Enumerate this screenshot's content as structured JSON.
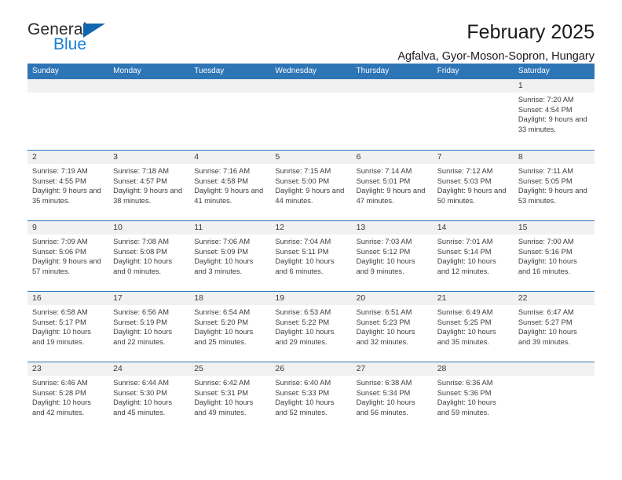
{
  "brand": {
    "name_top": "General",
    "name_bottom": "Blue",
    "triangle_icon": "triangle-icon",
    "accent_color": "#1a7fd4"
  },
  "header": {
    "title": "February 2025",
    "subtitle": "Agfalva, Gyor-Moson-Sopron, Hungary"
  },
  "colors": {
    "header_blue": "#2e75b6",
    "daynum_gray": "#f1f1f1",
    "text": "#3d3d3d"
  },
  "calendar": {
    "weekdays": [
      "Sunday",
      "Monday",
      "Tuesday",
      "Wednesday",
      "Thursday",
      "Friday",
      "Saturday"
    ],
    "labels": {
      "sunrise": "Sunrise:",
      "sunset": "Sunset:",
      "daylight": "Daylight:"
    },
    "weeks": [
      [
        {
          "day": "",
          "empty": true
        },
        {
          "day": "",
          "empty": true
        },
        {
          "day": "",
          "empty": true
        },
        {
          "day": "",
          "empty": true
        },
        {
          "day": "",
          "empty": true
        },
        {
          "day": "",
          "empty": true
        },
        {
          "day": "1",
          "sunrise": "Sunrise: 7:20 AM",
          "sunset": "Sunset: 4:54 PM",
          "daylight": "Daylight: 9 hours and 33 minutes."
        }
      ],
      [
        {
          "day": "2",
          "sunrise": "Sunrise: 7:19 AM",
          "sunset": "Sunset: 4:55 PM",
          "daylight": "Daylight: 9 hours and 35 minutes."
        },
        {
          "day": "3",
          "sunrise": "Sunrise: 7:18 AM",
          "sunset": "Sunset: 4:57 PM",
          "daylight": "Daylight: 9 hours and 38 minutes."
        },
        {
          "day": "4",
          "sunrise": "Sunrise: 7:16 AM",
          "sunset": "Sunset: 4:58 PM",
          "daylight": "Daylight: 9 hours and 41 minutes."
        },
        {
          "day": "5",
          "sunrise": "Sunrise: 7:15 AM",
          "sunset": "Sunset: 5:00 PM",
          "daylight": "Daylight: 9 hours and 44 minutes."
        },
        {
          "day": "6",
          "sunrise": "Sunrise: 7:14 AM",
          "sunset": "Sunset: 5:01 PM",
          "daylight": "Daylight: 9 hours and 47 minutes."
        },
        {
          "day": "7",
          "sunrise": "Sunrise: 7:12 AM",
          "sunset": "Sunset: 5:03 PM",
          "daylight": "Daylight: 9 hours and 50 minutes."
        },
        {
          "day": "8",
          "sunrise": "Sunrise: 7:11 AM",
          "sunset": "Sunset: 5:05 PM",
          "daylight": "Daylight: 9 hours and 53 minutes."
        }
      ],
      [
        {
          "day": "9",
          "sunrise": "Sunrise: 7:09 AM",
          "sunset": "Sunset: 5:06 PM",
          "daylight": "Daylight: 9 hours and 57 minutes."
        },
        {
          "day": "10",
          "sunrise": "Sunrise: 7:08 AM",
          "sunset": "Sunset: 5:08 PM",
          "daylight": "Daylight: 10 hours and 0 minutes."
        },
        {
          "day": "11",
          "sunrise": "Sunrise: 7:06 AM",
          "sunset": "Sunset: 5:09 PM",
          "daylight": "Daylight: 10 hours and 3 minutes."
        },
        {
          "day": "12",
          "sunrise": "Sunrise: 7:04 AM",
          "sunset": "Sunset: 5:11 PM",
          "daylight": "Daylight: 10 hours and 6 minutes."
        },
        {
          "day": "13",
          "sunrise": "Sunrise: 7:03 AM",
          "sunset": "Sunset: 5:12 PM",
          "daylight": "Daylight: 10 hours and 9 minutes."
        },
        {
          "day": "14",
          "sunrise": "Sunrise: 7:01 AM",
          "sunset": "Sunset: 5:14 PM",
          "daylight": "Daylight: 10 hours and 12 minutes."
        },
        {
          "day": "15",
          "sunrise": "Sunrise: 7:00 AM",
          "sunset": "Sunset: 5:16 PM",
          "daylight": "Daylight: 10 hours and 16 minutes."
        }
      ],
      [
        {
          "day": "16",
          "sunrise": "Sunrise: 6:58 AM",
          "sunset": "Sunset: 5:17 PM",
          "daylight": "Daylight: 10 hours and 19 minutes."
        },
        {
          "day": "17",
          "sunrise": "Sunrise: 6:56 AM",
          "sunset": "Sunset: 5:19 PM",
          "daylight": "Daylight: 10 hours and 22 minutes."
        },
        {
          "day": "18",
          "sunrise": "Sunrise: 6:54 AM",
          "sunset": "Sunset: 5:20 PM",
          "daylight": "Daylight: 10 hours and 25 minutes."
        },
        {
          "day": "19",
          "sunrise": "Sunrise: 6:53 AM",
          "sunset": "Sunset: 5:22 PM",
          "daylight": "Daylight: 10 hours and 29 minutes."
        },
        {
          "day": "20",
          "sunrise": "Sunrise: 6:51 AM",
          "sunset": "Sunset: 5:23 PM",
          "daylight": "Daylight: 10 hours and 32 minutes."
        },
        {
          "day": "21",
          "sunrise": "Sunrise: 6:49 AM",
          "sunset": "Sunset: 5:25 PM",
          "daylight": "Daylight: 10 hours and 35 minutes."
        },
        {
          "day": "22",
          "sunrise": "Sunrise: 6:47 AM",
          "sunset": "Sunset: 5:27 PM",
          "daylight": "Daylight: 10 hours and 39 minutes."
        }
      ],
      [
        {
          "day": "23",
          "sunrise": "Sunrise: 6:46 AM",
          "sunset": "Sunset: 5:28 PM",
          "daylight": "Daylight: 10 hours and 42 minutes."
        },
        {
          "day": "24",
          "sunrise": "Sunrise: 6:44 AM",
          "sunset": "Sunset: 5:30 PM",
          "daylight": "Daylight: 10 hours and 45 minutes."
        },
        {
          "day": "25",
          "sunrise": "Sunrise: 6:42 AM",
          "sunset": "Sunset: 5:31 PM",
          "daylight": "Daylight: 10 hours and 49 minutes."
        },
        {
          "day": "26",
          "sunrise": "Sunrise: 6:40 AM",
          "sunset": "Sunset: 5:33 PM",
          "daylight": "Daylight: 10 hours and 52 minutes."
        },
        {
          "day": "27",
          "sunrise": "Sunrise: 6:38 AM",
          "sunset": "Sunset: 5:34 PM",
          "daylight": "Daylight: 10 hours and 56 minutes."
        },
        {
          "day": "28",
          "sunrise": "Sunrise: 6:36 AM",
          "sunset": "Sunset: 5:36 PM",
          "daylight": "Daylight: 10 hours and 59 minutes."
        },
        {
          "day": "",
          "empty": true
        }
      ]
    ]
  }
}
